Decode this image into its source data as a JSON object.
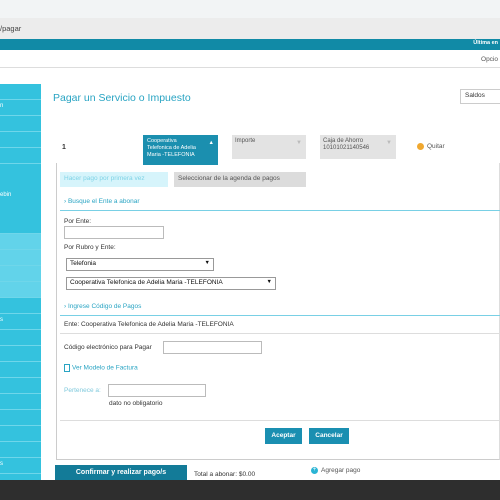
{
  "browser": {
    "url_fragment": "/pagar"
  },
  "topbar": {
    "right_text": "Última en",
    "opciones": "Opcio"
  },
  "page": {
    "title": "Pagar un Servicio o Impuesto",
    "saldos": "Saldos"
  },
  "payment_row": {
    "number": "1",
    "ente_lines": [
      "Cooperativa",
      "Telefonica de Adelia",
      "Maria -TELEFONIA"
    ],
    "importe": "Importe",
    "cuenta_lines": [
      "Caja de Ahorro",
      "10101021140546"
    ],
    "quitar": "Quitar"
  },
  "tabs": {
    "manual": "Hacer pago por primera vez",
    "agenda": "Seleccionar de la agenda de pagos"
  },
  "form": {
    "busque_section": "› Busque el Ente a abonar",
    "por_ente_label": "Por Ente:",
    "por_ente_value": "",
    "por_rubro_label": "Por Rubro y Ente:",
    "rubro_selected": "Telefonia",
    "ente_selected": "Cooperativa Telefonica de Adelia Maria -TELEFONIA",
    "codigo_section": "› Ingrese Código de Pagos",
    "ente_info": "Ente: Cooperativa Telefonica de Adelia Maria -TELEFONIA",
    "codigo_label": "Código electrónico para Pagar",
    "codigo_value": "",
    "ver_modelo": "Ver Modelo de Factura",
    "pertenece_label": "Pertenece a:",
    "pertenece_value": "",
    "dato_no_obligatorio": "dato no obligatorio",
    "aceptar": "Aceptar",
    "cancelar": "Cancelar"
  },
  "footer": {
    "confirm": "Confirmar y realizar pago/s",
    "total_label": "Total a abonar:",
    "total_value": "$0.00",
    "agregar": "Agregar pago"
  },
  "sidebar": {
    "items": [
      {
        "label": ""
      },
      {
        "label": "n"
      },
      {
        "label": ""
      },
      {
        "label": ""
      },
      {
        "label": ""
      },
      {
        "label": "ebin"
      },
      {
        "label": ""
      },
      {
        "label": ""
      },
      {
        "label": ""
      },
      {
        "label": ""
      },
      {
        "label": ""
      },
      {
        "label": ""
      },
      {
        "label": ""
      },
      {
        "label": ""
      },
      {
        "label": "s"
      },
      {
        "label": ""
      },
      {
        "label": ""
      },
      {
        "label": ""
      },
      {
        "label": ""
      },
      {
        "label": ""
      },
      {
        "label": ""
      },
      {
        "label": ""
      },
      {
        "label": ""
      },
      {
        "label": "s"
      }
    ]
  },
  "colors": {
    "accent": "#29a4c3",
    "sidebar": "#34c2de",
    "primary_button": "#1a8fb1",
    "quitar_icon": "#f0a830"
  }
}
